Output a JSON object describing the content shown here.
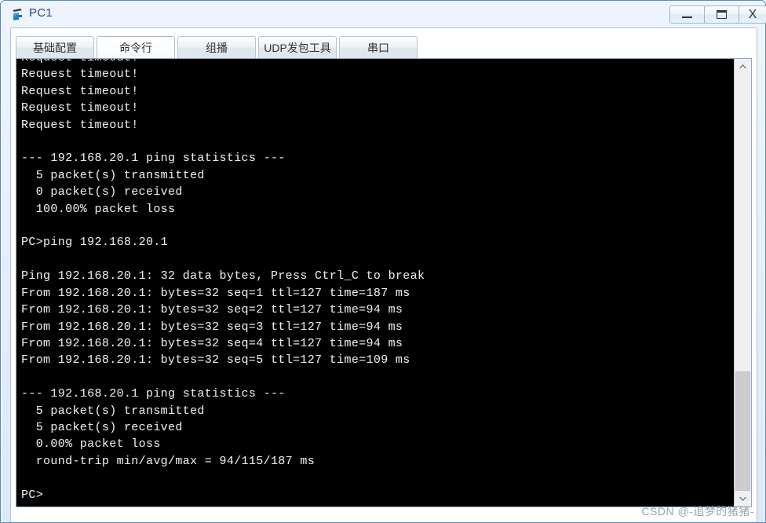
{
  "window": {
    "title": "PC1",
    "icon": "pc-device-icon",
    "controls": {
      "minimize_label": "—",
      "maximize_label": "❐",
      "close_label": "X"
    }
  },
  "tabs": [
    {
      "id": "basic-config",
      "label": "基础配置",
      "active": false
    },
    {
      "id": "command-line",
      "label": "命令行",
      "active": true
    },
    {
      "id": "multicast",
      "label": "组播",
      "active": false
    },
    {
      "id": "udp-tool",
      "label": "UDP发包工具",
      "active": false
    },
    {
      "id": "serial-port",
      "label": "串口",
      "active": false
    }
  ],
  "terminal": {
    "prompt": "PC>",
    "text": "Request timeout!\nRequest timeout!\nRequest timeout!\nRequest timeout!\nRequest timeout!\n\n--- 192.168.20.1 ping statistics ---\n  5 packet(s) transmitted\n  0 packet(s) received\n  100.00% packet loss\n\nPC>ping 192.168.20.1\n\nPing 192.168.20.1: 32 data bytes, Press Ctrl_C to break\nFrom 192.168.20.1: bytes=32 seq=1 ttl=127 time=187 ms\nFrom 192.168.20.1: bytes=32 seq=2 ttl=127 time=94 ms\nFrom 192.168.20.1: bytes=32 seq=3 ttl=127 time=94 ms\nFrom 192.168.20.1: bytes=32 seq=4 ttl=127 time=94 ms\nFrom 192.168.20.1: bytes=32 seq=5 ttl=127 time=109 ms\n\n--- 192.168.20.1 ping statistics ---\n  5 packet(s) transmitted\n  5 packet(s) received\n  0.00% packet loss\n  round-trip min/avg/max = 94/115/187 ms\n\nPC>",
    "lines": [
      "Request timeout!",
      "Request timeout!",
      "Request timeout!",
      "Request timeout!",
      "Request timeout!",
      "",
      "--- 192.168.20.1 ping statistics ---",
      "  5 packet(s) transmitted",
      "  0 packet(s) received",
      "  100.00% packet loss",
      "",
      "PC>ping 192.168.20.1",
      "",
      "Ping 192.168.20.1: 32 data bytes, Press Ctrl_C to break",
      "From 192.168.20.1: bytes=32 seq=1 ttl=127 time=187 ms",
      "From 192.168.20.1: bytes=32 seq=2 ttl=127 time=94 ms",
      "From 192.168.20.1: bytes=32 seq=3 ttl=127 time=94 ms",
      "From 192.168.20.1: bytes=32 seq=4 ttl=127 time=94 ms",
      "From 192.168.20.1: bytes=32 seq=5 ttl=127 time=109 ms",
      "",
      "--- 192.168.20.1 ping statistics ---",
      "  5 packet(s) transmitted",
      "  5 packet(s) received",
      "  0.00% packet loss",
      "  round-trip min/avg/max = 94/115/187 ms",
      "",
      "PC>"
    ],
    "foreground_color": "#e8e8e8",
    "background_color": "#000000"
  },
  "scrollbar": {
    "up_arrow": "chevron-up-icon",
    "down_arrow": "chevron-down-icon"
  },
  "watermark": {
    "text": "CSDN @-追梦的猪猪-"
  }
}
